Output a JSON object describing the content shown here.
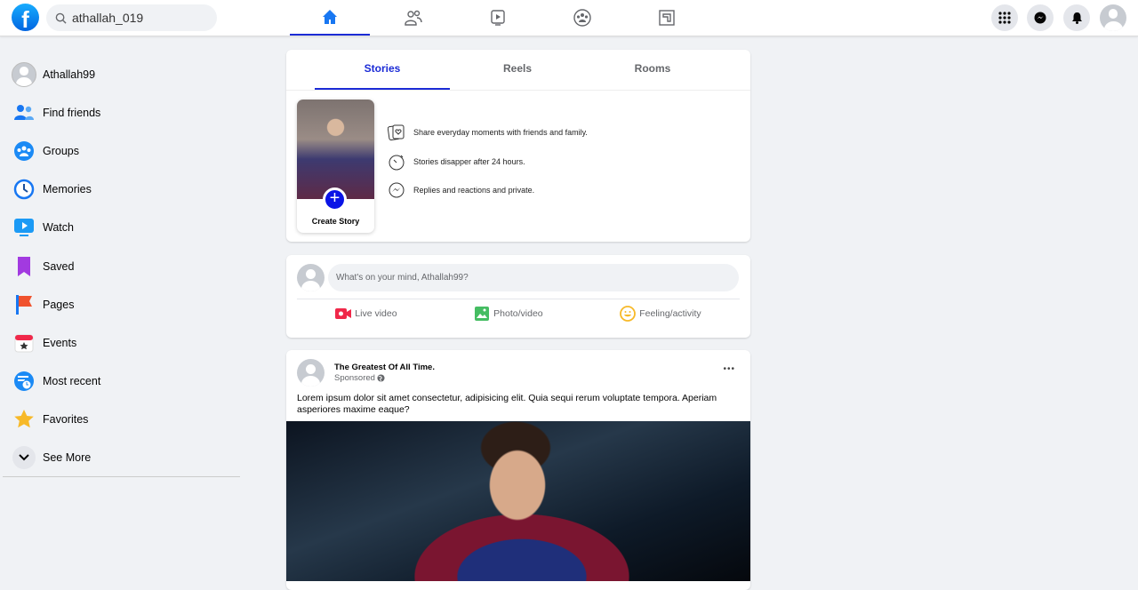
{
  "header": {
    "logo_letter": "f",
    "search_value": "athallah_019",
    "nav": [
      "home",
      "friends",
      "watch",
      "groups",
      "gaming"
    ],
    "active_nav": "home",
    "right": [
      "menu-grid",
      "messenger",
      "notifications",
      "profile"
    ]
  },
  "sidebar": {
    "items": [
      {
        "label": "Athallah99",
        "icon": "avatar"
      },
      {
        "label": "Find friends",
        "icon": "friends-icon"
      },
      {
        "label": "Groups",
        "icon": "groups-icon"
      },
      {
        "label": "Memories",
        "icon": "memories-icon"
      },
      {
        "label": "Watch",
        "icon": "watch-icon"
      },
      {
        "label": "Saved",
        "icon": "saved-icon"
      },
      {
        "label": "Pages",
        "icon": "pages-icon"
      },
      {
        "label": "Events",
        "icon": "events-icon"
      },
      {
        "label": "Most recent",
        "icon": "most-recent-icon"
      },
      {
        "label": "Favorites",
        "icon": "favorites-icon"
      },
      {
        "label": "See More",
        "icon": "chevron-down-icon"
      }
    ]
  },
  "stories": {
    "tabs": [
      "Stories",
      "Reels",
      "Rooms"
    ],
    "active_tab": "Stories",
    "create_label": "Create Story",
    "features": [
      "Share everyday moments with friends and family.",
      "Stories disapper after 24 hours.",
      "Replies and reactions and private."
    ]
  },
  "composer": {
    "placeholder": "What's on your mind, Athallah99?",
    "actions": [
      "Live video",
      "Photo/video",
      "Feeling/activity"
    ]
  },
  "post": {
    "author": "The Greatest Of All Time.",
    "meta": "Sponsored",
    "text": "Lorem ipsum dolor sit amet consectetur, adipisicing elit. Quia sequi rerum voluptate tempora. Aperiam asperiores maxime eaque?",
    "more": "•••"
  },
  "colors": {
    "accent": "#1b2bd6",
    "background": "#f0f2f5"
  }
}
